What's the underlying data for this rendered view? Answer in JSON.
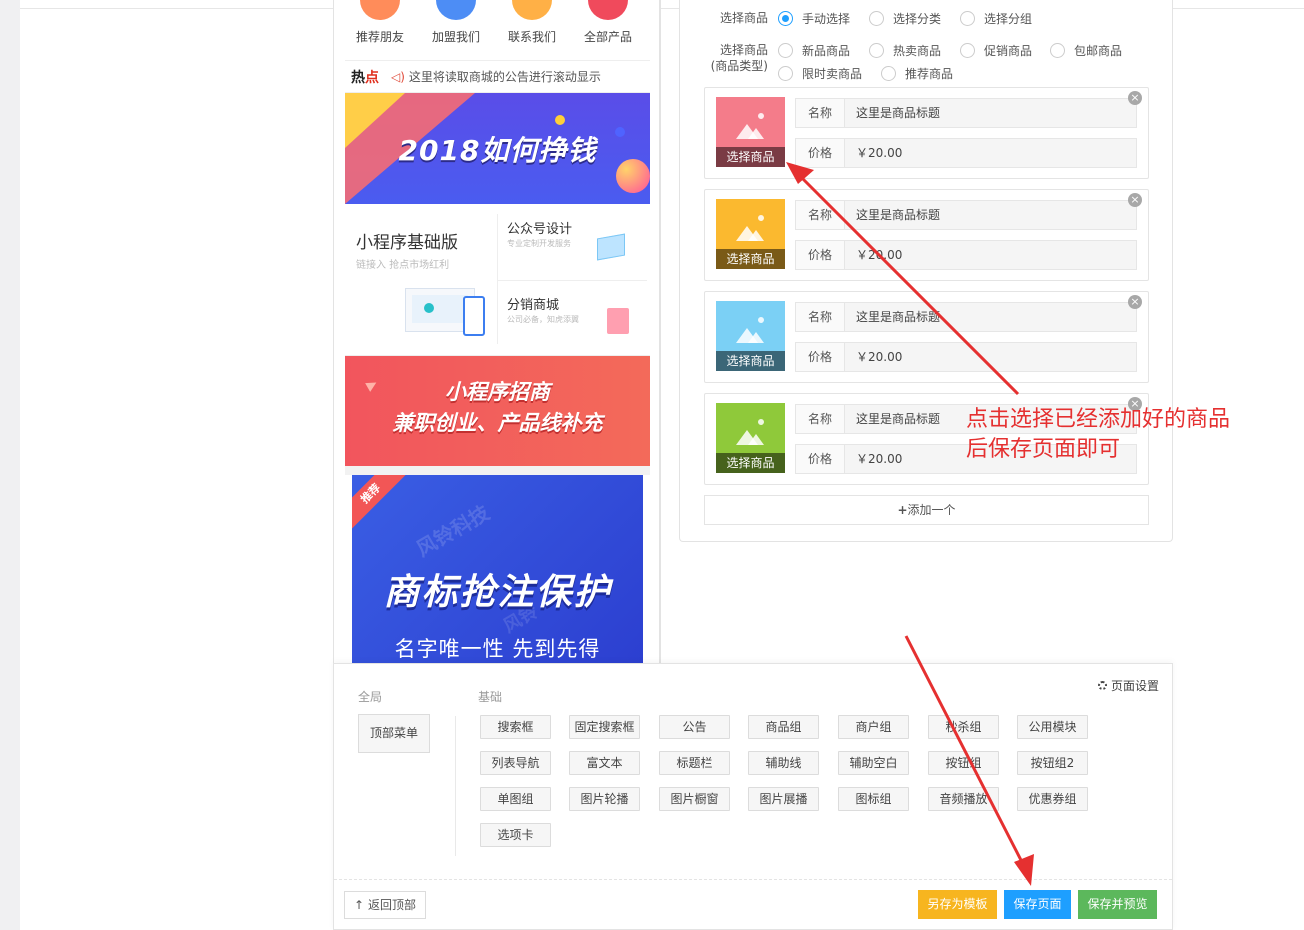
{
  "colors": {
    "accent_blue": "#1e9fff",
    "save_template": "#f7b51f",
    "save_page": "#1e9fff",
    "save_preview": "#5cb85c",
    "annotation_red": "#e53030"
  },
  "phone": {
    "nav_items": [
      {
        "label": "推荐朋友",
        "color": "#ff8c5a"
      },
      {
        "label": "加盟我们",
        "color": "#4d8df5"
      },
      {
        "label": "联系我们",
        "color": "#ffb046"
      },
      {
        "label": "全部产品",
        "color": "#f04a5c"
      }
    ],
    "notice": {
      "tag_black": "热",
      "tag_red": "点",
      "speaker_icon": "speaker-icon",
      "text": "这里将读取商城的公告进行滚动显示"
    },
    "banner1": {
      "title": "2018如何挣钱"
    },
    "promo": {
      "big_title": "小程序基础版",
      "big_sub": "链接入  抢点市场红利",
      "item1_title": "公众号设计",
      "item1_sub": "专业定制开发服务",
      "item2_title": "分销商城",
      "item2_sub": "公司必备，知虎添翼"
    },
    "banner2": {
      "line1": "小程序招商",
      "line2": "兼职创业、产品线补充"
    },
    "banner3": {
      "ribbon": "推荐",
      "watermark1": "风铃科技",
      "watermark2": "风铃",
      "title": "商标抢注保护",
      "subtitle": "名字唯一性 先到先得"
    }
  },
  "settings": {
    "select_label": "选择商品",
    "select_options": [
      {
        "label": "手动选择",
        "checked": true
      },
      {
        "label": "选择分类",
        "checked": false
      },
      {
        "label": "选择分组",
        "checked": false
      }
    ],
    "type_label_1": "选择商品",
    "type_label_2": "(商品类型)",
    "type_options_row1": [
      "新品商品",
      "热卖商品",
      "促销商品",
      "包邮商品"
    ],
    "type_options_row2": [
      "限时卖商品",
      "推荐商品"
    ],
    "products": [
      {
        "name_label": "名称",
        "name": "这里是商品标题",
        "price_label": "价格",
        "price": "￥20.00",
        "select_label": "选择商品",
        "color": "#f47c8a",
        "bar_color": "#7a3b44"
      },
      {
        "name_label": "名称",
        "name": "这里是商品标题",
        "price_label": "价格",
        "price": "￥20.00",
        "select_label": "选择商品",
        "color": "#fbb92f",
        "bar_color": "#7a5a17"
      },
      {
        "name_label": "名称",
        "name": "这里是商品标题",
        "price_label": "价格",
        "price": "￥20.00",
        "select_label": "选择商品",
        "color": "#7bd0f5",
        "bar_color": "#3b6677"
      },
      {
        "name_label": "名称",
        "name": "这里是商品标题",
        "price_label": "价格",
        "price": "￥20.00",
        "select_label": "选择商品",
        "color": "#8fc93a",
        "bar_color": "#46621c"
      }
    ],
    "close_glyph": "×",
    "add_one": "添加一个"
  },
  "annotation": {
    "line1": "点击选择已经添加好的商品",
    "line2": "后保存页面即可"
  },
  "components": {
    "global_label": "全局",
    "basic_label": "基础",
    "page_settings": "页面设置",
    "top_menu": "顶部菜单",
    "buttons": [
      [
        "搜索框",
        "固定搜索框",
        "公告",
        "商品组",
        "商户组",
        "秒杀组",
        "公用模块"
      ],
      [
        "列表导航",
        "富文本",
        "标题栏",
        "辅助线",
        "辅助空白",
        "按钮组",
        "按钮组2"
      ],
      [
        "单图组",
        "图片轮播",
        "图片橱窗",
        "图片展播",
        "图标组",
        "音频播放",
        "优惠券组"
      ],
      [
        "选项卡"
      ]
    ],
    "back_top": "返回顶部",
    "save_template": "另存为模板",
    "save_page": "保存页面",
    "save_preview": "保存并预览"
  }
}
